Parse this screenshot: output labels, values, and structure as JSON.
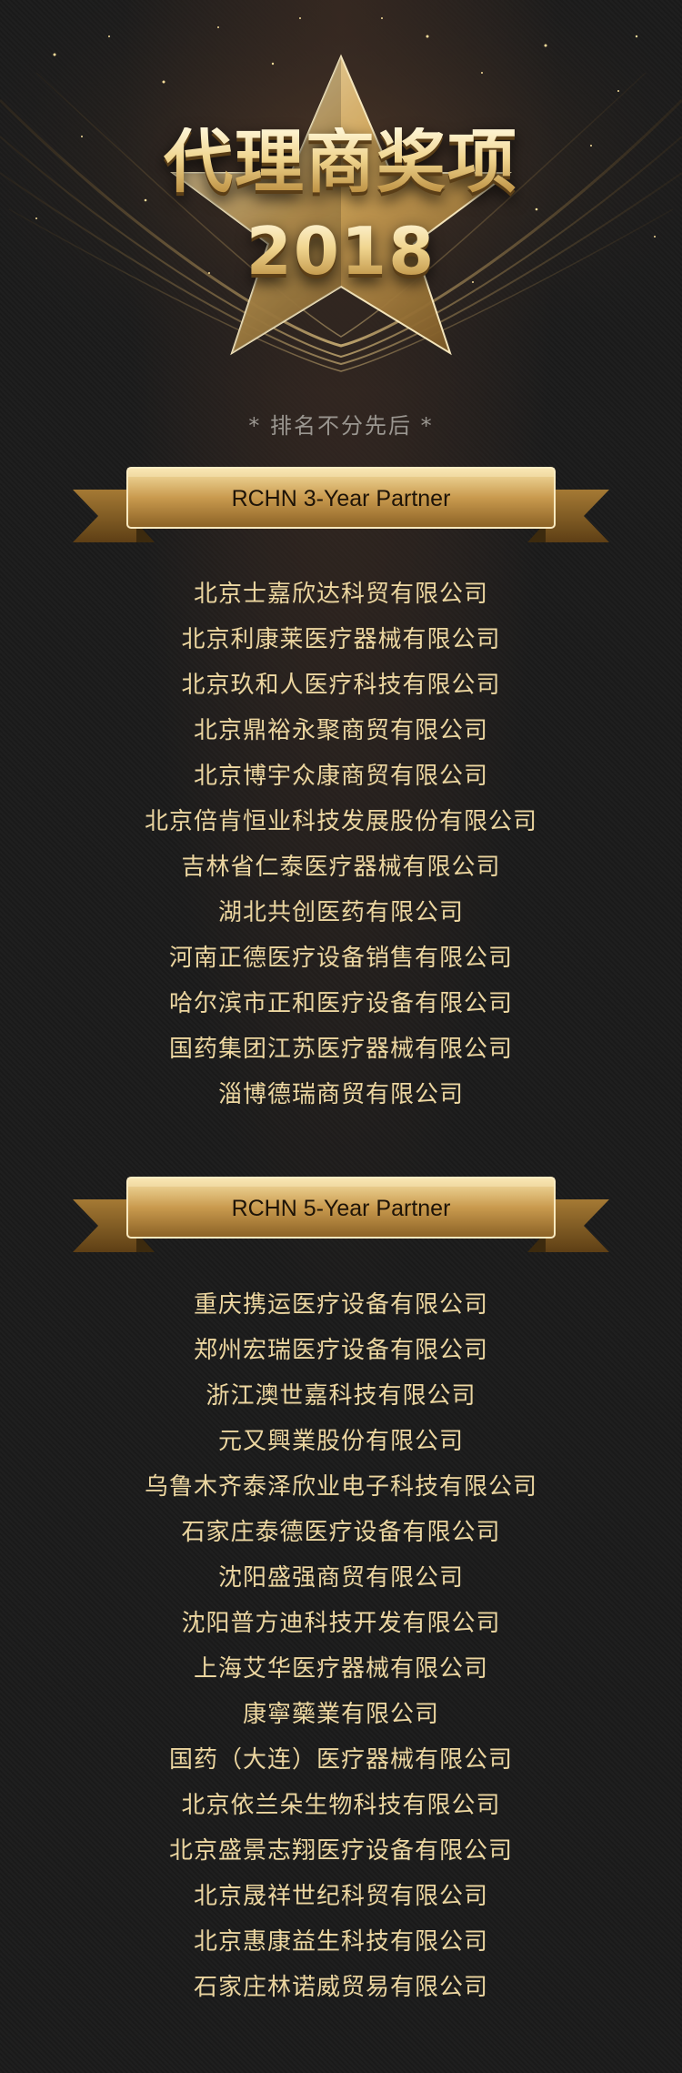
{
  "hero": {
    "title": "代理商奖项",
    "year": "2018"
  },
  "note": "* 排名不分先后 *",
  "colors": {
    "gold": "#e0b96a",
    "text": "#ecd6a0",
    "background": "#1b1b1b"
  },
  "sections": [
    {
      "label": "RCHN 3-Year Partner",
      "companies": [
        "北京士嘉欣达科贸有限公司",
        "北京利康莱医疗器械有限公司",
        "北京玖和人医疗科技有限公司",
        "北京鼎裕永聚商贸有限公司",
        "北京博宇众康商贸有限公司",
        "北京倍肯恒业科技发展股份有限公司",
        "吉林省仁泰医疗器械有限公司",
        "湖北共创医药有限公司",
        "河南正德医疗设备销售有限公司",
        "哈尔滨市正和医疗设备有限公司",
        "国药集团江苏医疗器械有限公司",
        "淄博德瑞商贸有限公司"
      ]
    },
    {
      "label": "RCHN 5-Year Partner",
      "companies": [
        "重庆携运医疗设备有限公司",
        "郑州宏瑞医疗设备有限公司",
        "浙江澳世嘉科技有限公司",
        "元又興業股份有限公司",
        "乌鲁木齐泰泽欣业电子科技有限公司",
        "石家庄泰德医疗设备有限公司",
        "沈阳盛强商贸有限公司",
        "沈阳普方迪科技开发有限公司",
        "上海艾华医疗器械有限公司",
        "康寧藥業有限公司",
        "国药（大连）医疗器械有限公司",
        "北京依兰朵生物科技有限公司",
        "北京盛景志翔医疗设备有限公司",
        "北京晟祥世纪科贸有限公司",
        "北京惠康益生科技有限公司",
        "石家庄林诺威贸易有限公司"
      ]
    }
  ]
}
